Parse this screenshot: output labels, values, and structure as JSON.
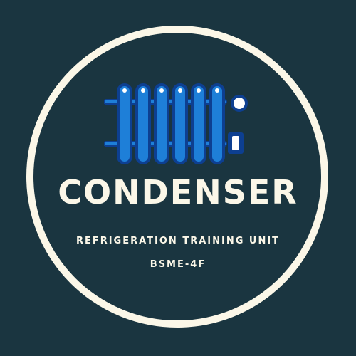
{
  "logo": {
    "title": "CONDENSER",
    "subtitle": "REFRIGERATION TRAINING UNIT",
    "code": "BSME-4F",
    "icon": "radiator-icon"
  },
  "colors": {
    "background": "#1a3540",
    "ring": "#fbf7e8",
    "text": "#fbf7e8",
    "icon_fill": "#1e7fd8",
    "icon_outline": "#0d3f91",
    "icon_highlight": "#ffffff"
  }
}
